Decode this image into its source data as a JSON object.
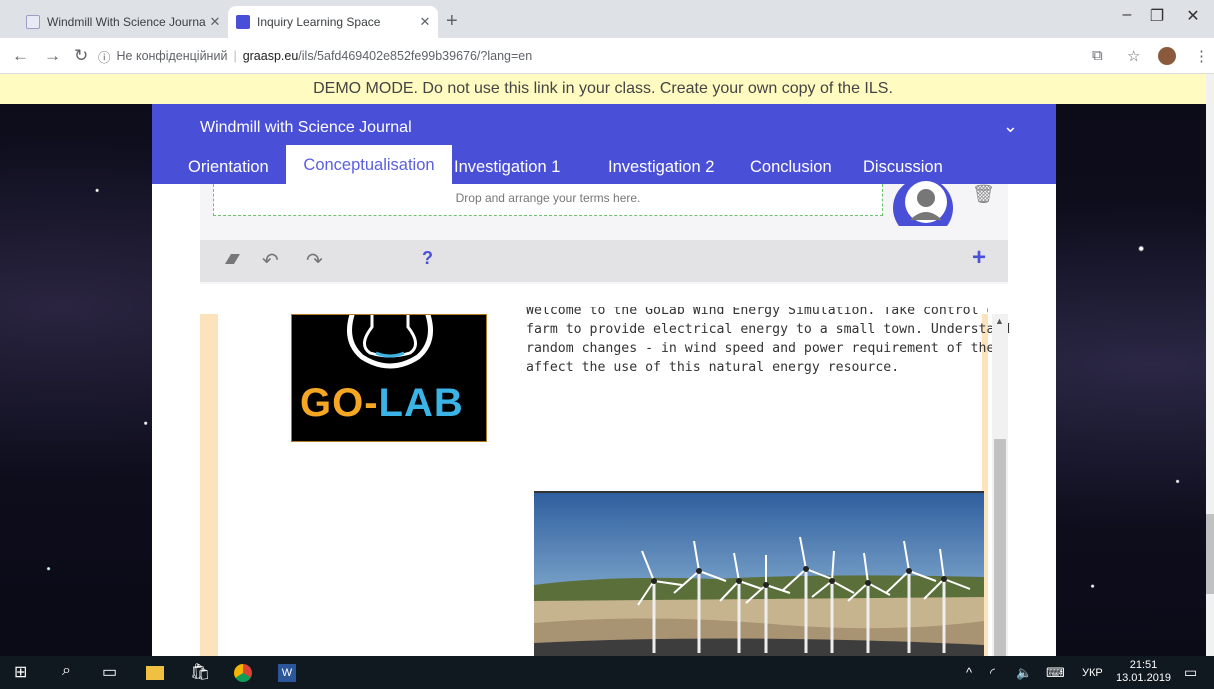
{
  "browser": {
    "tabs": [
      {
        "title": "Windmill With Science Journal | G"
      },
      {
        "title": "Inquiry Learning Space"
      }
    ],
    "new_tab": "+",
    "security_label": "Не конфіденційний",
    "url_host": "graasp.eu",
    "url_path": "/ils/5afd469402e852fe99b39676/?lang=en"
  },
  "banner": {
    "text": "DEMO MODE. Do not use this link in your class. Create your own copy of the ILS."
  },
  "ils": {
    "title": "Windmill with Science Journal",
    "phases": [
      "Orientation",
      "Conceptualisation",
      "Investigation 1",
      "Investigation 2",
      "Conclusion",
      "Discussion"
    ],
    "active_phase": "Conceptualisation"
  },
  "concept_map": {
    "drop_placeholder": "Drop and arrange your terms here.",
    "help_label": "?",
    "add_label": "+"
  },
  "simulation": {
    "logo_text_go": "GO-",
    "logo_text_lab": "LAB",
    "description_cut": "Welcome to the GoLab Wind Energy Simulation. Take control of",
    "description_lines": [
      "farm to provide electrical energy to a small town. Understand",
      "random changes - in wind speed and power requirement of the",
      "affect the use of this natural energy resource."
    ]
  },
  "taskbar": {
    "language": "УКР",
    "time": "21:51",
    "date": "13.01.2019"
  },
  "colors": {
    "header": "#4a4fd8",
    "banner": "#fffbc1",
    "stripe": "#fde3bc"
  }
}
